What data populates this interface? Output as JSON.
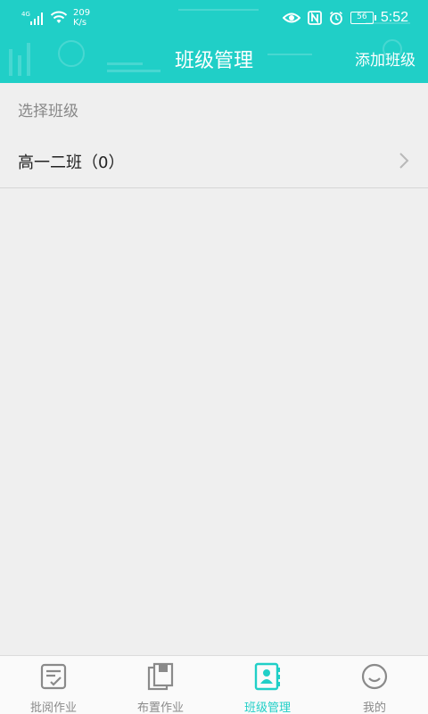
{
  "colors": {
    "accent": "#20cfc7",
    "background": "#efefef",
    "nav_inactive": "#8a8a8a"
  },
  "status_bar": {
    "network": "4G",
    "speed_value": "209",
    "speed_unit": "K/s",
    "battery": "56",
    "time": "5:52",
    "icons": [
      "signal-icon",
      "wifi-icon",
      "eye-icon",
      "nfc-icon",
      "alarm-icon",
      "battery-icon"
    ]
  },
  "header": {
    "title": "班级管理",
    "add_button": "添加班级"
  },
  "content": {
    "section_label": "选择班级",
    "classes": [
      {
        "label": "高一二班（0）"
      }
    ]
  },
  "bottom_nav": {
    "items": [
      {
        "label": "批阅作业",
        "icon": "review-homework-icon",
        "active": false
      },
      {
        "label": "布置作业",
        "icon": "assign-homework-icon",
        "active": false
      },
      {
        "label": "班级管理",
        "icon": "class-management-icon",
        "active": true
      },
      {
        "label": "我的",
        "icon": "profile-icon",
        "active": false
      }
    ]
  }
}
